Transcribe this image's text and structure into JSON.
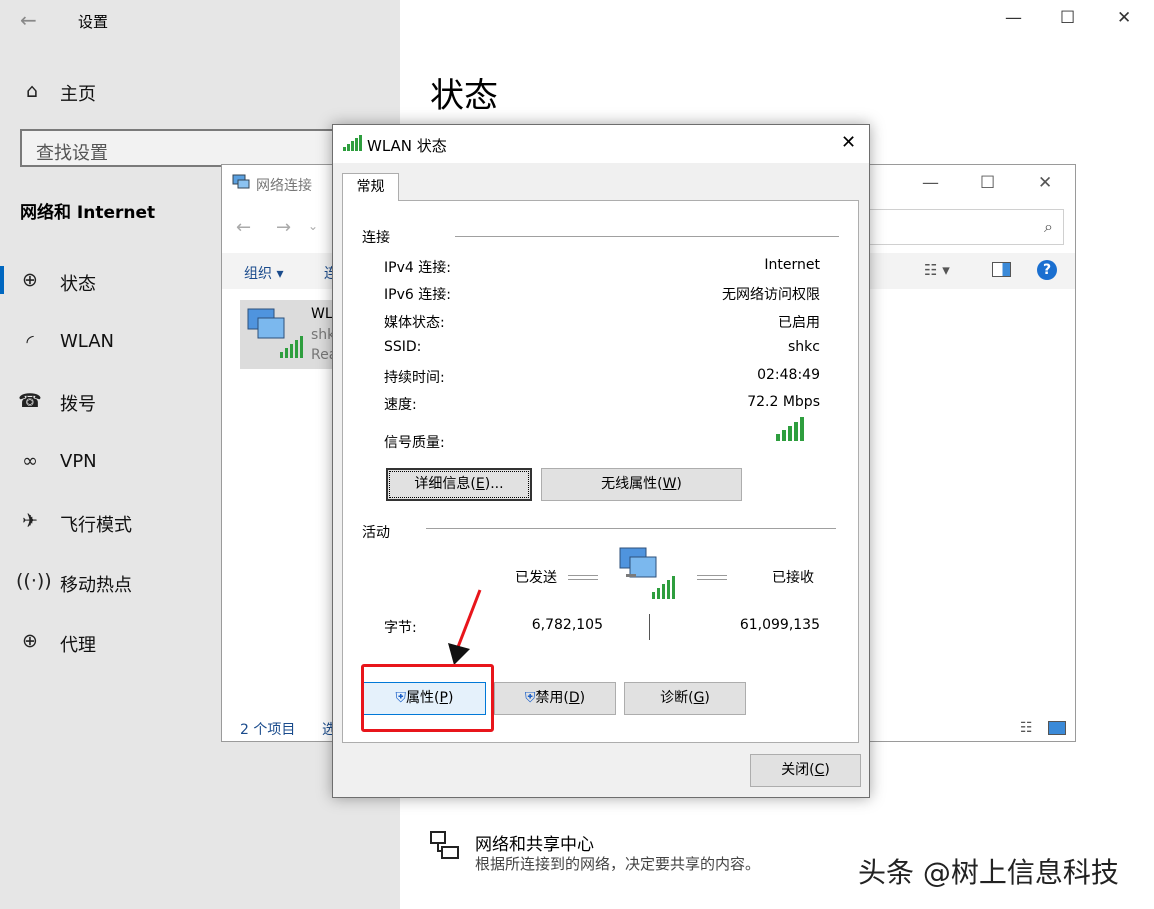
{
  "settings": {
    "title": "设置",
    "home": "主页",
    "search_placeholder": "查找设置",
    "section": "网络和 Internet",
    "nav": [
      {
        "label": "状态",
        "icon": "globe-icon"
      },
      {
        "label": "WLAN",
        "icon": "wifi-icon"
      },
      {
        "label": "拨号",
        "icon": "dialup-icon"
      },
      {
        "label": "VPN",
        "icon": "vpn-icon"
      },
      {
        "label": "飞行模式",
        "icon": "airplane-icon"
      },
      {
        "label": "移动热点",
        "icon": "hotspot-icon"
      },
      {
        "label": "代理",
        "icon": "globe-icon"
      }
    ],
    "page_title": "状态",
    "sharing_center": {
      "title": "网络和共享中心",
      "desc": "根据所连接到的网络，决定要共享的内容。"
    }
  },
  "explorer": {
    "title": "网络连接",
    "toolbar_organize": "组织 ▾",
    "toolbar_connect": "连",
    "item": {
      "name": "WL",
      "line2": "shk",
      "line3": "Rea"
    },
    "status_count": "2 个项目",
    "status_selected": "选"
  },
  "dialog": {
    "title": "WLAN 状态",
    "tab": "常规",
    "connection_header": "连接",
    "rows": [
      {
        "label": "IPv4 连接:",
        "value": "Internet"
      },
      {
        "label": "IPv6 连接:",
        "value": "无网络访问权限"
      },
      {
        "label": "媒体状态:",
        "value": "已启用"
      },
      {
        "label": "SSID:",
        "value": "shkc"
      },
      {
        "label": "持续时间:",
        "value": "02:48:49"
      },
      {
        "label": "速度:",
        "value": "72.2 Mbps"
      }
    ],
    "signal_label": "信号质量:",
    "signal_bars": 5,
    "btn_details": {
      "text": "详细信息(",
      "key": "E",
      "tail": ")..."
    },
    "btn_wireless": {
      "text": "无线属性(",
      "key": "W",
      "tail": ")"
    },
    "activity_header": "活动",
    "sent_label": "已发送",
    "received_label": "已接收",
    "bytes_label": "字节:",
    "bytes_sent": "6,782,105",
    "bytes_received": "61,099,135",
    "btn_properties": {
      "text": "属性(",
      "key": "P",
      "tail": ")"
    },
    "btn_disable": {
      "text": "禁用(",
      "key": "D",
      "tail": ")"
    },
    "btn_diagnose": {
      "text": "诊断(",
      "key": "G",
      "tail": ")"
    },
    "btn_close": {
      "text": "关闭(",
      "key": "C",
      "tail": ")"
    }
  },
  "watermark": "头条 @树上信息科技",
  "colors": {
    "accent": "#0067c0",
    "highlight_box": "#e8151b",
    "sidebar_bg": "#e6e6e6",
    "signal_green": "#2e9e3e"
  }
}
